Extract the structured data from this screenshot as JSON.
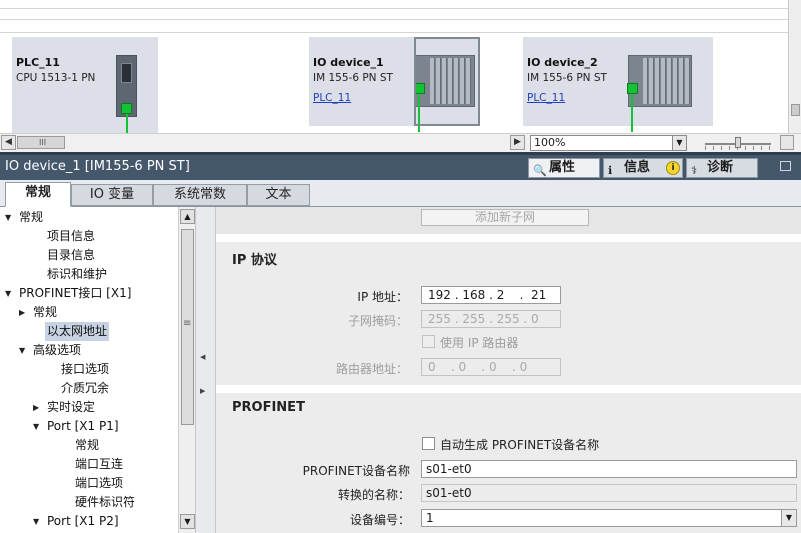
{
  "network_view": {
    "devices": [
      {
        "name": "PLC_11",
        "type": "CPU 1513-1 PN",
        "link": ""
      },
      {
        "name": "IO device_1",
        "type": "IM 155-6 PN ST",
        "link": "PLC_11"
      },
      {
        "name": "IO device_2",
        "type": "IM 155-6 PN ST",
        "link": "PLC_11"
      }
    ],
    "zoom_value": "100%",
    "scroll_thumb_glyph": "III",
    "scroll_left_glyph": "◀",
    "scroll_right_glyph": "▶",
    "dropdown_glyph": "▼"
  },
  "inspector": {
    "title": "IO device_1 [IM155-6 PN ST]",
    "tabs": [
      {
        "label": "属性",
        "icon": "properties-icon",
        "glyph": "🔍"
      },
      {
        "label": "信息",
        "icon": "info-icon",
        "glyph": "ℹ"
      },
      {
        "label": "诊断",
        "icon": "diagnostics-icon",
        "glyph": "⚕"
      }
    ],
    "info_badge": "i"
  },
  "property_tabs": [
    "常规",
    "IO 变量",
    "系统常数",
    "文本"
  ],
  "tree": {
    "items": [
      {
        "label": "常规",
        "indent": 0,
        "expander": "▼"
      },
      {
        "label": "项目信息",
        "indent": 2,
        "expander": ""
      },
      {
        "label": "目录信息",
        "indent": 2,
        "expander": ""
      },
      {
        "label": "标识和维护",
        "indent": 2,
        "expander": ""
      },
      {
        "label": "PROFINET接口 [X1]",
        "indent": 0,
        "expander": "▼"
      },
      {
        "label": "常规",
        "indent": 1,
        "expander": "▶"
      },
      {
        "label": "以太网地址",
        "indent": 2,
        "expander": "",
        "selected": true
      },
      {
        "label": "高级选项",
        "indent": 1,
        "expander": "▼"
      },
      {
        "label": "接口选项",
        "indent": 3,
        "expander": ""
      },
      {
        "label": "介质冗余",
        "indent": 3,
        "expander": ""
      },
      {
        "label": "实时设定",
        "indent": 2,
        "expander": "▶"
      },
      {
        "label": "Port [X1 P1]",
        "indent": 2,
        "expander": "▼"
      },
      {
        "label": "常规",
        "indent": 4,
        "expander": ""
      },
      {
        "label": "端口互连",
        "indent": 4,
        "expander": ""
      },
      {
        "label": "端口选项",
        "indent": 4,
        "expander": ""
      },
      {
        "label": "硬件标识符",
        "indent": 4,
        "expander": ""
      },
      {
        "label": "Port [X1 P2]",
        "indent": 2,
        "expander": "▼"
      }
    ],
    "scroll_up": "▲",
    "scroll_down": "▼",
    "thumb_glyph": "≡"
  },
  "panel": {
    "add_subnet_button": "添加新子网",
    "ip_section": {
      "title": "IP 协议",
      "ip_label": "IP 地址：",
      "ip_value": "192 . 168 . 2    .  21",
      "mask_label": "子网掩码：",
      "mask_value": "255 . 255 . 255 . 0",
      "router_checkbox": "使用 IP 路由器",
      "router_label": "路由器地址：",
      "router_value": "0    . 0    . 0    . 0"
    },
    "profinet_section": {
      "title": "PROFINET",
      "auto_checkbox": "自动生成 PROFINET设备名称",
      "name_label": "PROFINET设备名称",
      "name_value": "s01-et0",
      "converted_label": "转换的名称：",
      "converted_value": "s01-et0",
      "number_label": "设备编号：",
      "number_value": "1"
    }
  },
  "colors": {
    "inspector_header": "#45576b",
    "port_green": "#16c235",
    "link_blue": "#2141b9",
    "device_bg": "#dcdfe7"
  }
}
